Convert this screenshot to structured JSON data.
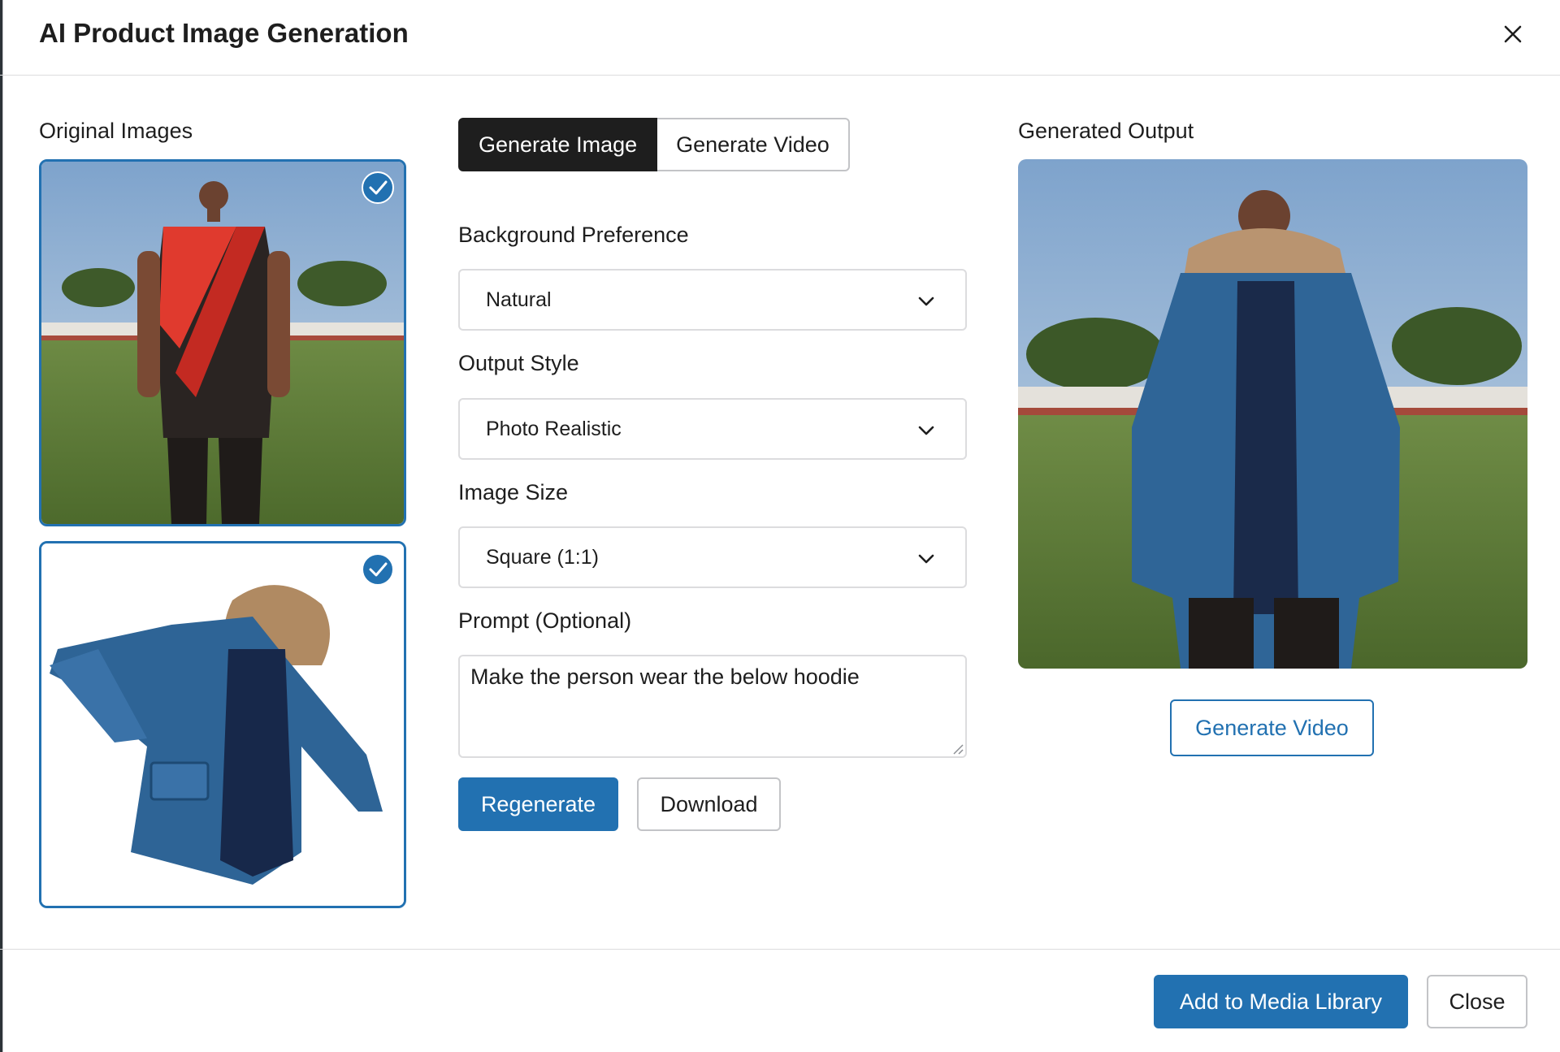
{
  "modal": {
    "title": "AI Product Image Generation",
    "close_icon": "close-icon"
  },
  "original": {
    "label": "Original Images",
    "images": [
      {
        "description_icon": "person-image",
        "selected": true
      },
      {
        "description_icon": "jacket-image",
        "selected": true
      }
    ]
  },
  "tabs": [
    {
      "label": "Generate Image",
      "active": true
    },
    {
      "label": "Generate Video",
      "active": false
    }
  ],
  "form": {
    "background": {
      "label": "Background Preference",
      "value": "Natural"
    },
    "style": {
      "label": "Output Style",
      "value": "Photo Realistic"
    },
    "size": {
      "label": "Image Size",
      "value": "Square (1:1)"
    },
    "prompt": {
      "label": "Prompt (Optional)",
      "value": "Make the person wear the below hoodie"
    }
  },
  "actions": {
    "regenerate": "Regenerate",
    "download": "Download"
  },
  "output": {
    "label": "Generated Output",
    "generate_video": "Generate Video"
  },
  "footer": {
    "add_media": "Add to Media Library",
    "close": "Close"
  },
  "colors": {
    "accent": "#2271b1",
    "dark": "#1e1e1e",
    "border": "#c3c4c7"
  }
}
